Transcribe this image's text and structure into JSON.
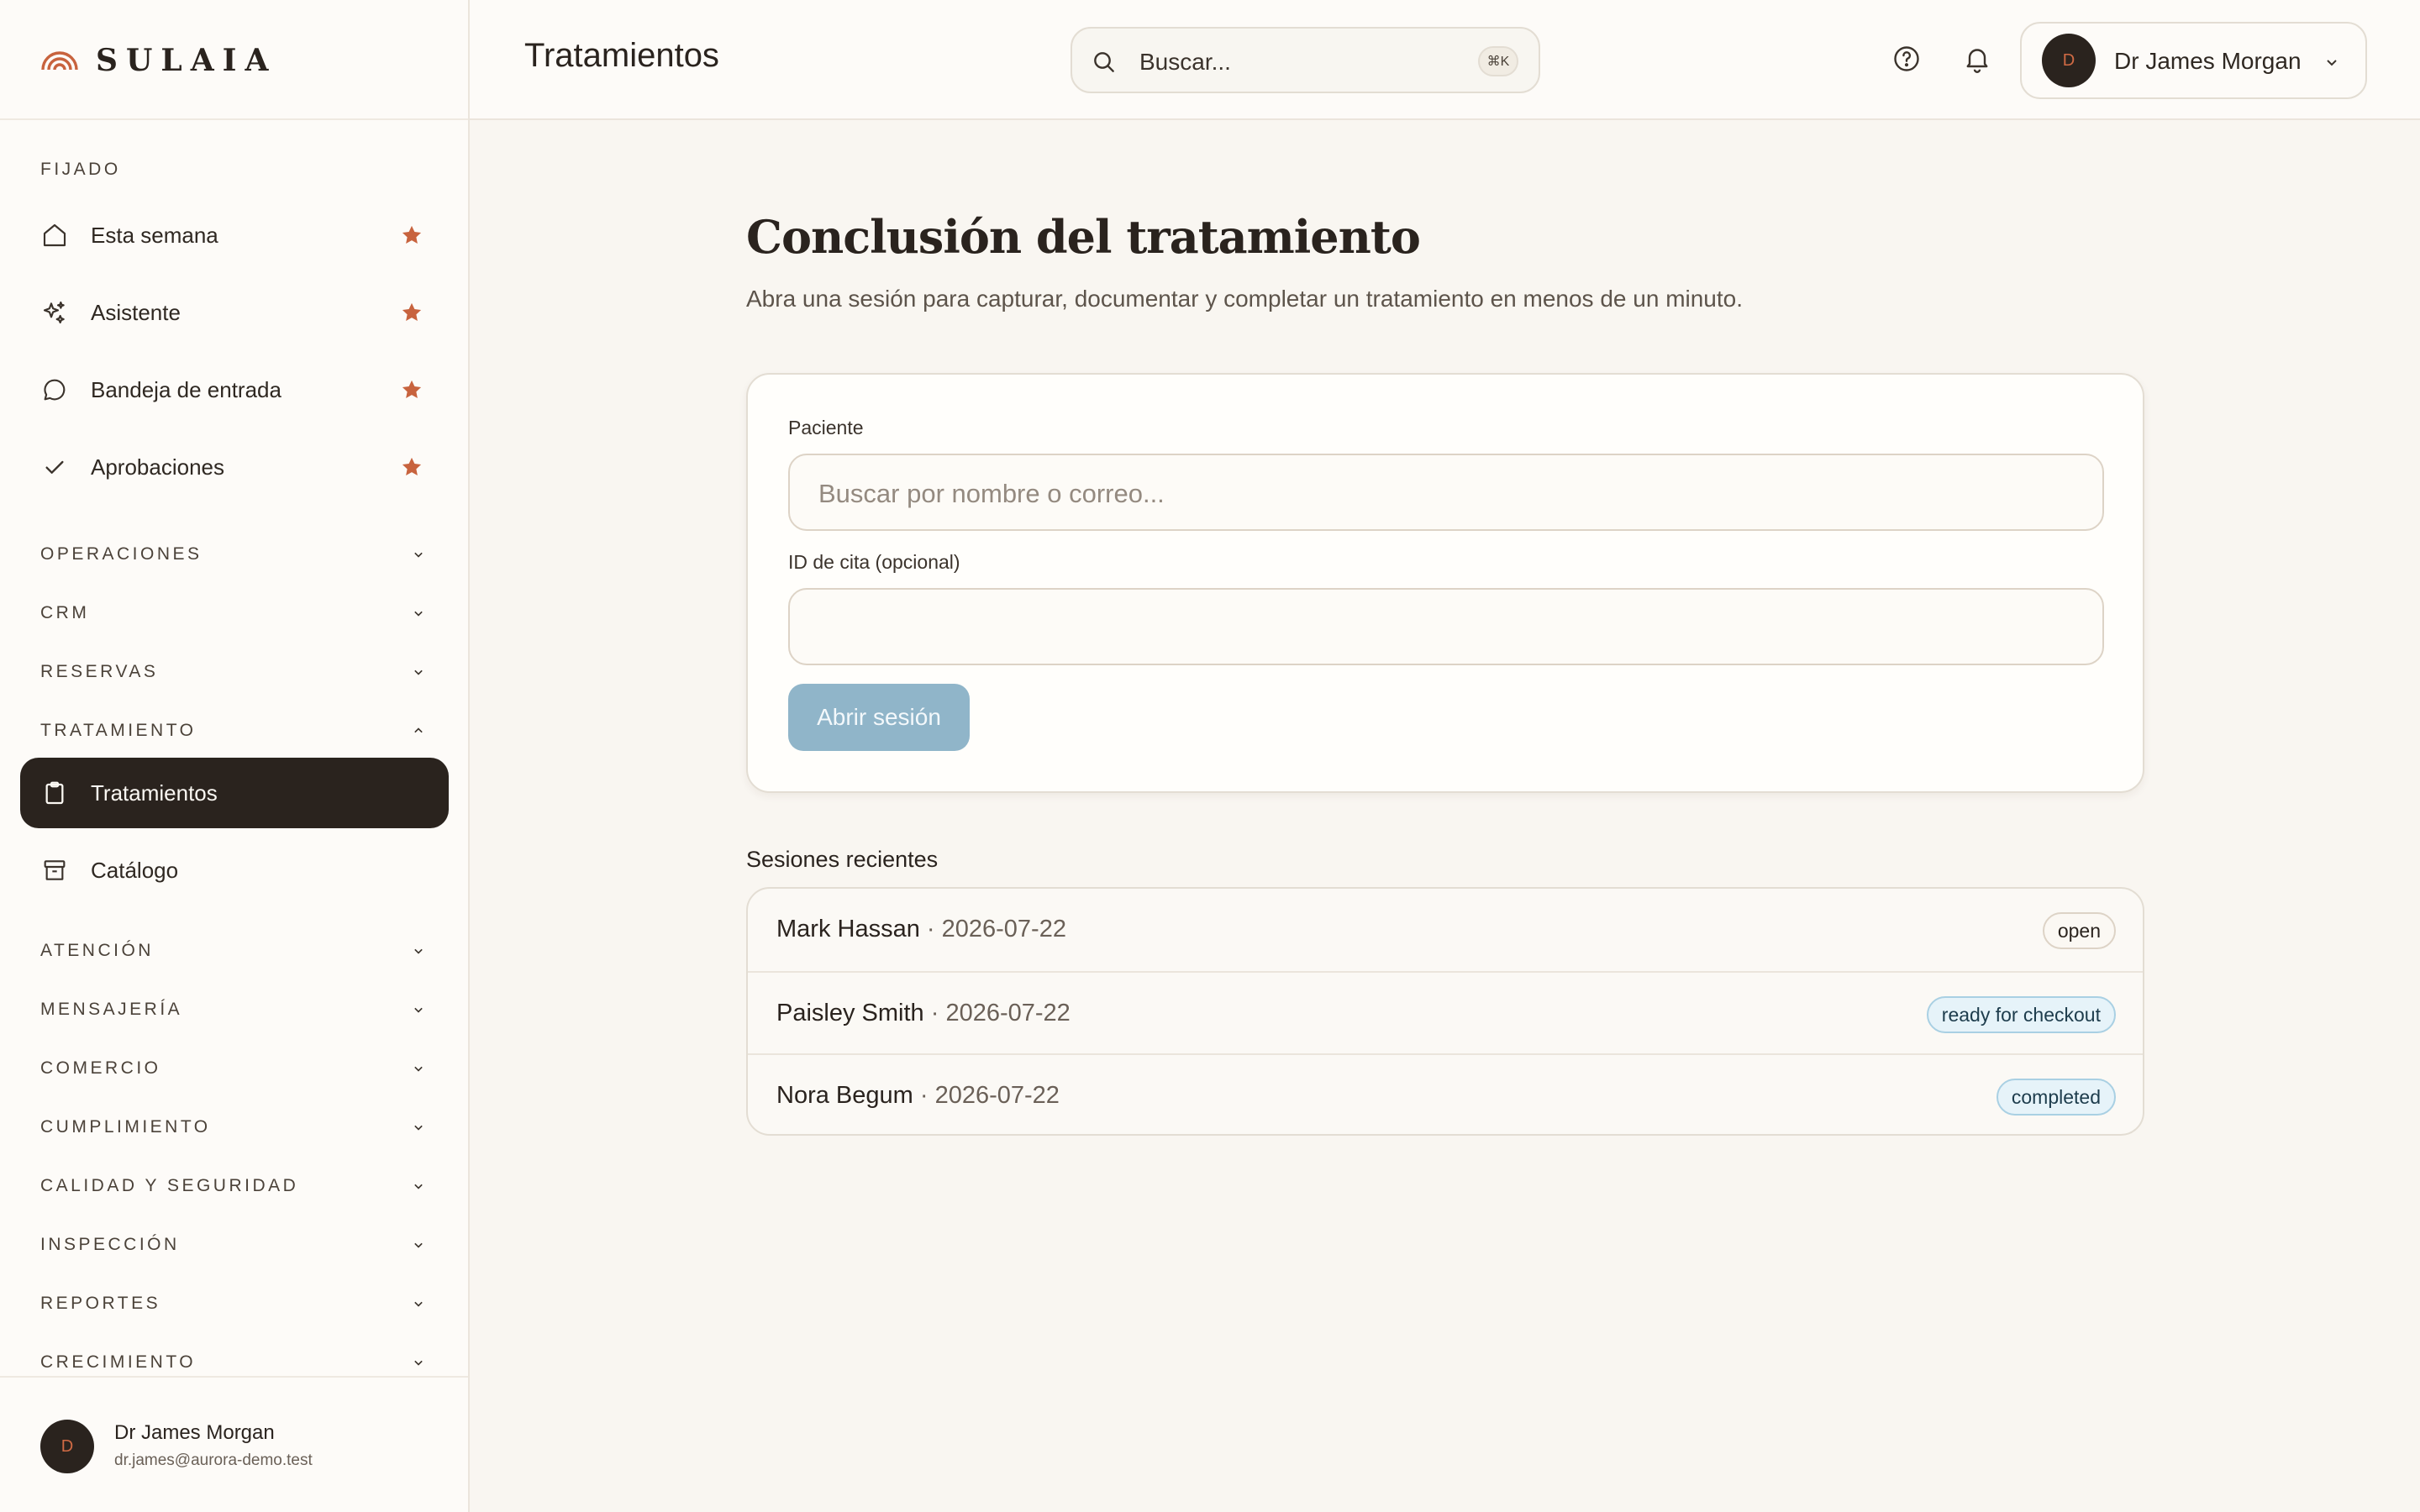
{
  "brand": {
    "name": "SULAIA",
    "accent": "#c8633e"
  },
  "sidebar": {
    "pinned_label": "FIJADO",
    "pinned": [
      {
        "label": "Esta semana",
        "icon": "home-icon"
      },
      {
        "label": "Asistente",
        "icon": "sparkles-icon"
      },
      {
        "label": "Bandeja de entrada",
        "icon": "chat-bubble-icon"
      },
      {
        "label": "Aprobaciones",
        "icon": "check-icon"
      }
    ],
    "sections": {
      "operaciones": "OPERACIONES",
      "crm": "CRM",
      "reservas": "RESERVAS",
      "tratamiento": "TRATAMIENTO",
      "atencion": "ATENCIÓN",
      "mensajeria": "MENSAJERÍA",
      "comercio": "COMERCIO",
      "cumplimiento": "CUMPLIMIENTO",
      "calidad": "CALIDAD Y SEGURIDAD",
      "inspeccion": "INSPECCIÓN",
      "reportes": "REPORTES",
      "crecimiento": "CRECIMIENTO"
    },
    "treatment_items": [
      {
        "label": "Tratamientos",
        "icon": "clipboard-icon",
        "active": true
      },
      {
        "label": "Catálogo",
        "icon": "archive-box-icon",
        "active": false
      }
    ],
    "footer": {
      "initial": "D",
      "name": "Dr James Morgan",
      "email": "dr.james@aurora-demo.test"
    }
  },
  "topbar": {
    "title": "Tratamientos",
    "search_placeholder": "Buscar...",
    "search_shortcut": "⌘K",
    "user_initial": "D",
    "user_name": "Dr James Morgan"
  },
  "main": {
    "heading": "Conclusión del tratamiento",
    "subheading": "Abra una sesión para capturar, documentar y completar un tratamiento en menos de un minuto.",
    "form": {
      "patient_label": "Paciente",
      "patient_placeholder": "Buscar por nombre o correo...",
      "appointment_label": "ID de cita (opcional)",
      "appointment_value": "",
      "submit_label": "Abrir sesión"
    },
    "recent_label": "Sesiones recientes",
    "recent_sessions": [
      {
        "name": "Mark Hassan",
        "date": "2026-07-22",
        "status": "open"
      },
      {
        "name": "Paisley Smith",
        "date": "2026-07-22",
        "status": "ready for checkout"
      },
      {
        "name": "Nora Begum",
        "date": "2026-07-22",
        "status": "completed"
      }
    ]
  }
}
